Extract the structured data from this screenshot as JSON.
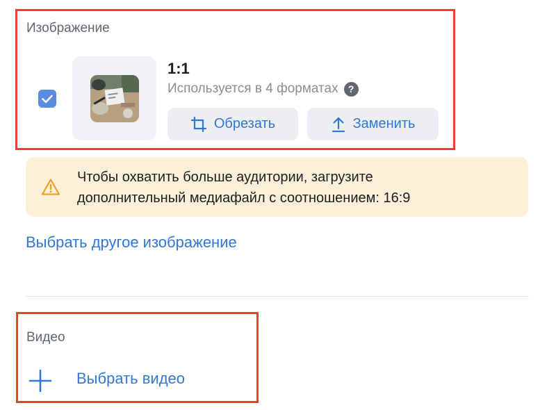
{
  "image_section": {
    "label": "Изображение",
    "selected": true,
    "ratio": "1:1",
    "usage_text": "Используется в 4 форматах",
    "help_icon": "?",
    "crop_button": "Обрезать",
    "replace_button": "Заменить"
  },
  "warning": {
    "icon": "warning-icon",
    "line1": "Чтобы охватить больше аудитории, загрузите",
    "line2": "дополнительный медиафайл с соотношением: 16:9"
  },
  "choose_other_image_link": "Выбрать другое изображение",
  "video_section": {
    "label": "Видео",
    "choose_video_link": "Выбрать видео"
  },
  "colors": {
    "accent": "#2f78d9",
    "highlight_border": "#e8432e",
    "warning_bg": "#fdf0d9",
    "checkbox": "#5b8be0"
  }
}
